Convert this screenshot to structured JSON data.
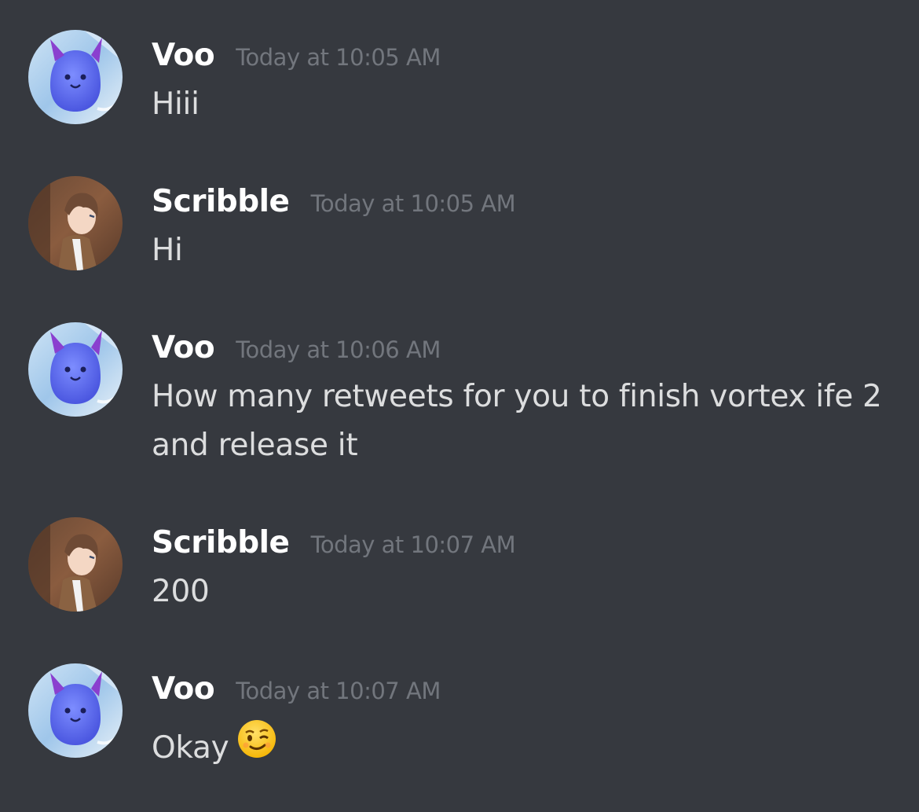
{
  "colors": {
    "background": "#36393f",
    "username": "#ffffff",
    "timestamp": "#72767d",
    "message_text": "#dcddde"
  },
  "messages": [
    {
      "author": "Voo",
      "timestamp": "Today at 10:05 AM",
      "text": "Hiii",
      "avatar_icon": "blue-creature-avatar"
    },
    {
      "author": "Scribble",
      "timestamp": "Today at 10:05 AM",
      "text": "Hi",
      "avatar_icon": "anime-boy-avatar"
    },
    {
      "author": "Voo",
      "timestamp": "Today at 10:06 AM",
      "text": "How many retweets for you to finish vortex ife 2 and release it",
      "avatar_icon": "blue-creature-avatar"
    },
    {
      "author": "Scribble",
      "timestamp": "Today at 10:07 AM",
      "text": "200",
      "avatar_icon": "anime-boy-avatar"
    },
    {
      "author": "Voo",
      "timestamp": "Today at 10:07 AM",
      "text": "Okay",
      "emoji": "winking-face-emoji",
      "avatar_icon": "blue-creature-avatar"
    }
  ]
}
